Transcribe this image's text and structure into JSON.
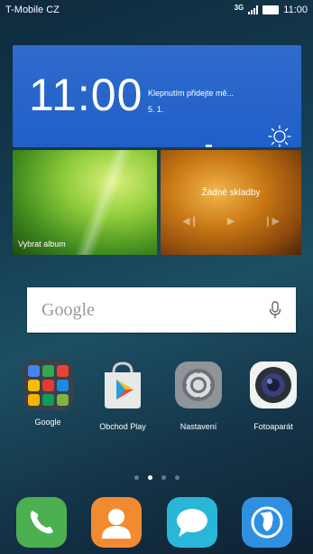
{
  "status_bar": {
    "carrier": "T-Mobile CZ",
    "network": "3G",
    "time": "11:00"
  },
  "clock_widget": {
    "time": "11:00",
    "weather_text": "Klepnutím přidejte mě...",
    "date": "5. 1.",
    "weather_icon": "sun-icon"
  },
  "album_widget": {
    "label": "Vybrat album"
  },
  "music_widget": {
    "title": "Žádné skladby",
    "controls": [
      "previous-icon",
      "play-icon",
      "next-icon"
    ]
  },
  "search": {
    "placeholder": "Google",
    "icon": "mic-icon"
  },
  "apps": [
    {
      "label": "Google",
      "icon": "google-folder-icon"
    },
    {
      "label": "Obchod Play",
      "icon": "play-store-icon"
    },
    {
      "label": "Nastavení",
      "icon": "settings-gear-icon"
    },
    {
      "label": "Fotoaparát",
      "icon": "camera-icon"
    }
  ],
  "page_indicator": {
    "pages": 4,
    "current": 2
  },
  "dock": [
    {
      "icon": "phone-icon",
      "color": "#4caf50"
    },
    {
      "icon": "contacts-icon",
      "color": "#f28b30"
    },
    {
      "icon": "messages-icon",
      "color": "#29b6d8"
    },
    {
      "icon": "browser-icon",
      "color": "#2f8fe0"
    }
  ]
}
